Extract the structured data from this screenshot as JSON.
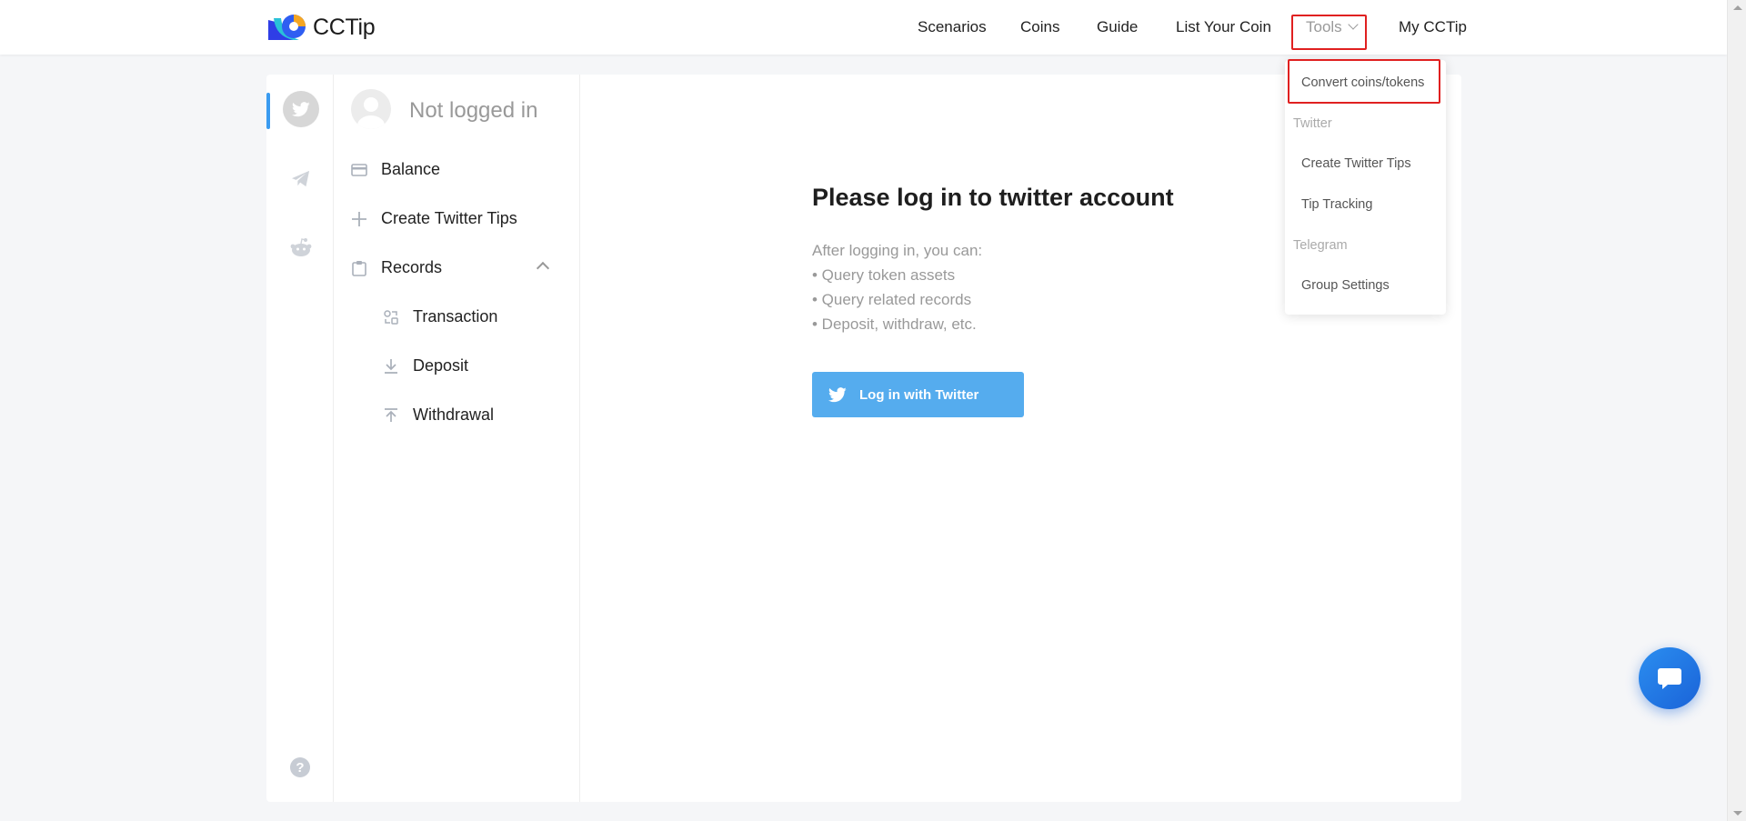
{
  "header": {
    "logo_text": "CCTip",
    "nav": {
      "scenarios": "Scenarios",
      "coins": "Coins",
      "guide": "Guide",
      "list_your_coin": "List Your Coin",
      "tools": "Tools",
      "my_cctip": "My CCTip"
    }
  },
  "tools_menu": {
    "convert": "Convert coins/tokens",
    "twitter_group": "Twitter",
    "create_twitter_tips": "Create Twitter Tips",
    "tip_tracking": "Tip Tracking",
    "telegram_group": "Telegram",
    "group_settings": "Group Settings"
  },
  "sidebar": {
    "rail": [
      "twitter-icon",
      "telegram-icon",
      "reddit-icon"
    ],
    "help": "?",
    "profile_label": "Not logged in",
    "items": {
      "balance": "Balance",
      "create_twitter_tips": "Create Twitter Tips",
      "records": "Records",
      "transaction": "Transaction",
      "deposit": "Deposit",
      "withdrawal": "Withdrawal"
    }
  },
  "main": {
    "title": "Please log in to twitter account",
    "intro": "After logging in, you can:",
    "bullets": [
      "• Query token assets",
      "• Query related records",
      "• Deposit, withdraw, etc."
    ],
    "login_button": "Log in with Twitter"
  },
  "colors": {
    "accent": "#55acee",
    "active_bar": "#3a9bf0",
    "highlight": "#e02020"
  }
}
